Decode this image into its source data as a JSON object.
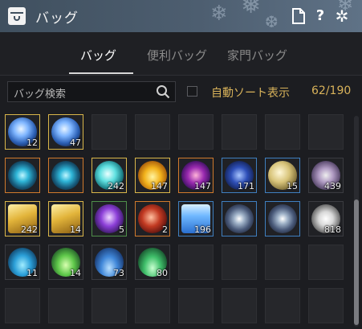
{
  "window": {
    "title": "バッグ"
  },
  "tabs": [
    {
      "label": "バッグ"
    },
    {
      "label": "便利バッグ"
    },
    {
      "label": "家門バッグ"
    }
  ],
  "search": {
    "placeholder": "バッグ検索"
  },
  "auto_sort": {
    "label": "自動ソート表示",
    "checked": false
  },
  "capacity": {
    "text": "62/190",
    "used": 62,
    "total": 190
  },
  "slots": [
    {
      "item": "blue-crystal-orb",
      "qty": "12",
      "quality": "gold"
    },
    {
      "item": "blue-crystal-orb",
      "qty": "47",
      "quality": "gold"
    },
    {
      "item": "",
      "qty": "",
      "quality": "none"
    },
    {
      "item": "",
      "qty": "",
      "quality": "none"
    },
    {
      "item": "",
      "qty": "",
      "quality": "none"
    },
    {
      "item": "",
      "qty": "",
      "quality": "none"
    },
    {
      "item": "",
      "qty": "",
      "quality": "none"
    },
    {
      "item": "",
      "qty": "",
      "quality": "none"
    },
    {
      "item": "teal-eye-stone",
      "qty": "",
      "quality": "orange"
    },
    {
      "item": "teal-eye-stone",
      "qty": "",
      "quality": "orange"
    },
    {
      "item": "glowing-teal-orb",
      "qty": "242",
      "quality": "gold"
    },
    {
      "item": "amber-drop",
      "qty": "147",
      "quality": "gold"
    },
    {
      "item": "violet-shard",
      "qty": "147",
      "quality": "orange"
    },
    {
      "item": "dark-blue-shard",
      "qty": "171",
      "quality": "blue"
    },
    {
      "item": "pale-gold-pearl",
      "qty": "15",
      "quality": "blue"
    },
    {
      "item": "silver-compass",
      "qty": "439",
      "quality": "none"
    },
    {
      "item": "gold-ingot",
      "qty": "242",
      "quality": "gold"
    },
    {
      "item": "gold-ingot",
      "qty": "14",
      "quality": "gold"
    },
    {
      "item": "purple-crystal",
      "qty": "5",
      "quality": "green"
    },
    {
      "item": "red-stone",
      "qty": "2",
      "quality": "orange"
    },
    {
      "item": "blue-potion",
      "qty": "196",
      "quality": "blue"
    },
    {
      "item": "gem-plate",
      "qty": "",
      "quality": "blue"
    },
    {
      "item": "gem-plate",
      "qty": "",
      "quality": "blue"
    },
    {
      "item": "white-coral",
      "qty": "818",
      "quality": "none"
    },
    {
      "item": "blue-coral",
      "qty": "11",
      "quality": "none"
    },
    {
      "item": "green-coral",
      "qty": "14",
      "quality": "none"
    },
    {
      "item": "blue-shell-coral",
      "qty": "73",
      "quality": "none"
    },
    {
      "item": "green-shell-coral",
      "qty": "80",
      "quality": "none"
    },
    {
      "item": "",
      "qty": "",
      "quality": "none"
    },
    {
      "item": "",
      "qty": "",
      "quality": "none"
    },
    {
      "item": "",
      "qty": "",
      "quality": "none"
    },
    {
      "item": "",
      "qty": "",
      "quality": "none"
    },
    {
      "item": "",
      "qty": "",
      "quality": "none"
    },
    {
      "item": "",
      "qty": "",
      "quality": "none"
    },
    {
      "item": "",
      "qty": "",
      "quality": "none"
    },
    {
      "item": "",
      "qty": "",
      "quality": "none"
    },
    {
      "item": "",
      "qty": "",
      "quality": "none"
    },
    {
      "item": "",
      "qty": "",
      "quality": "none"
    },
    {
      "item": "",
      "qty": "",
      "quality": "none"
    },
    {
      "item": "",
      "qty": "",
      "quality": "none"
    }
  ],
  "colors": {
    "accent_gold": "#d8b25a",
    "quality_gold": "#d9b64a",
    "quality_blue": "#3f7fbf",
    "quality_orange": "#d07a2c",
    "quality_green": "#4f8f4a"
  }
}
